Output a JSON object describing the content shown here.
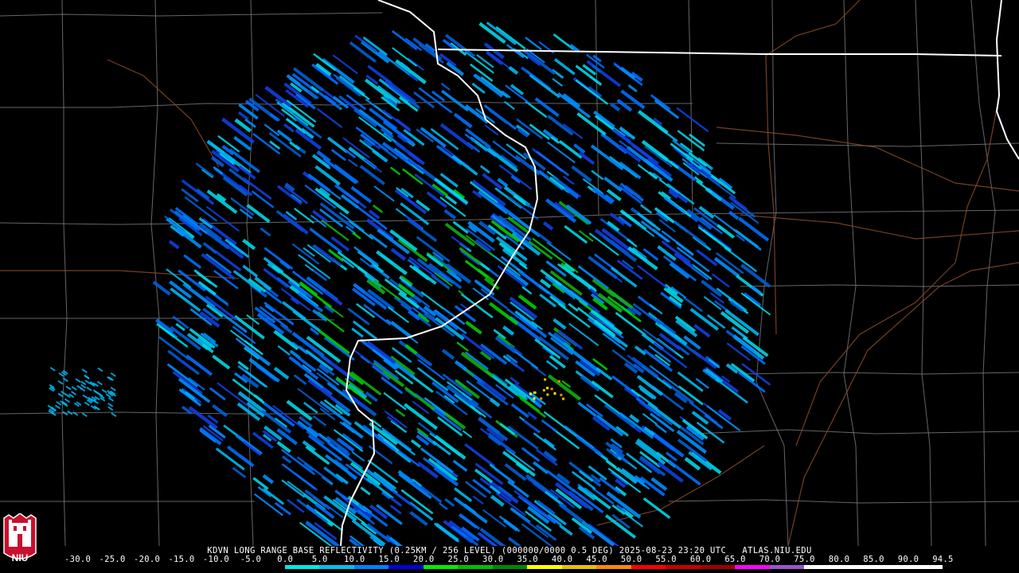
{
  "header": {
    "title": "KDVN LONG RANGE BASE REFLECTIVITY (0.25KM / 256 LEVEL) (000000/0000 0.5 DEG) 2025-08-23 23:20 UTC   ATLAS.NIU.EDU"
  },
  "logo": {
    "text": "NIU",
    "icon": "niu-castle-logo-icon",
    "color": "#c8102e"
  },
  "legend": {
    "labels": [
      "-30.0",
      "-25.0",
      "-20.0",
      "-15.0",
      "-10.0",
      "-5.0",
      "0.0",
      "5.0",
      "10.0",
      "15.0",
      "20.0",
      "25.0",
      "30.0",
      "35.0",
      "40.0",
      "45.0",
      "50.0",
      "55.0",
      "60.0",
      "65.0",
      "70.0",
      "75.0",
      "80.0",
      "85.0",
      "90.0",
      "94.5"
    ],
    "colors": [
      "#000000",
      "#000000",
      "#000000",
      "#000000",
      "#000000",
      "#000000",
      "#00e8e8",
      "#00c0f0",
      "#0080ff",
      "#0000e0",
      "#00f000",
      "#00c000",
      "#008800",
      "#ffff00",
      "#e8c000",
      "#ff8800",
      "#ff0000",
      "#c80000",
      "#a00000",
      "#ff00ff",
      "#9955cc",
      "#ffffff",
      "#ffffff",
      "#ffffff",
      "#ffffff"
    ]
  },
  "map": {
    "radar_site": "KDVN",
    "colors": {
      "state_border": "#ffffff",
      "county_line": "#888888",
      "highway": "#8b4a2b"
    }
  }
}
